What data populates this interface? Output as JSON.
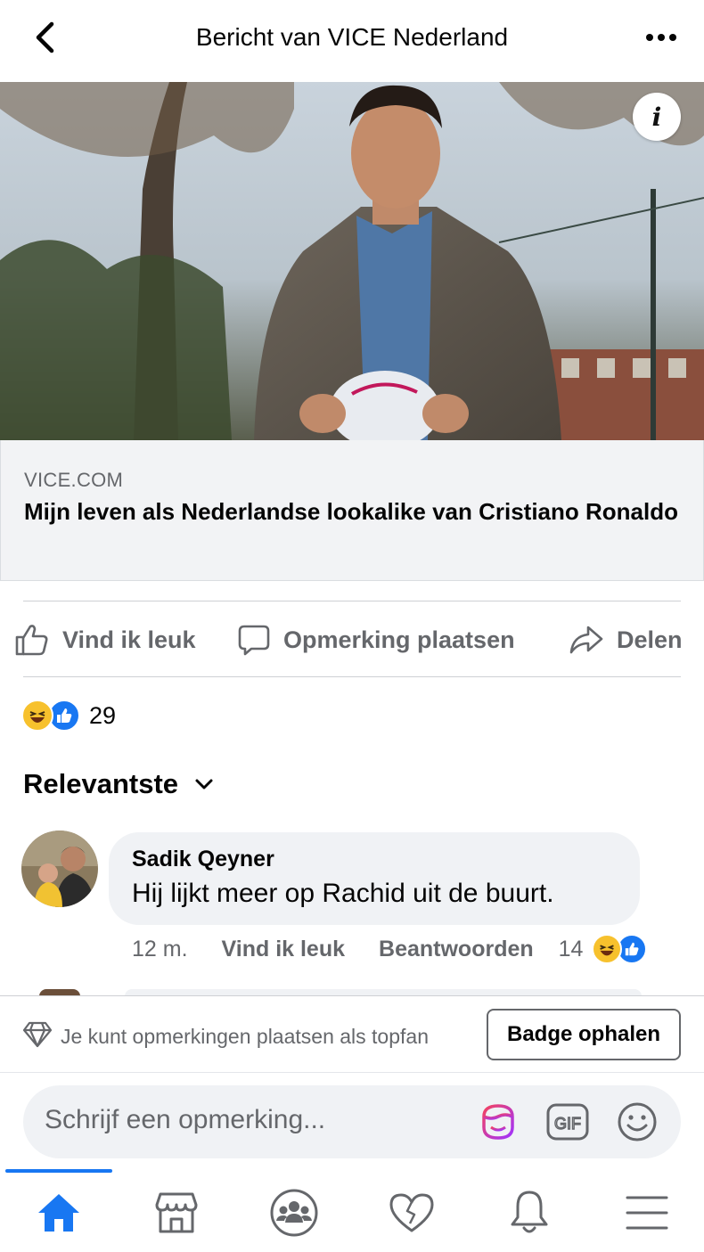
{
  "header": {
    "title": "Bericht van VICE Nederland",
    "back_icon": "chevron-left-icon",
    "more_icon": "more-dots-icon"
  },
  "hero": {
    "info_label": "i"
  },
  "link_preview": {
    "domain": "VICE.COM",
    "title": "Mijn leven als Nederlandse lookalike van Cristiano Ronaldo"
  },
  "actions": {
    "like_label": "Vind ik leuk",
    "comment_label": "Opmerking plaatsen",
    "share_label": "Delen"
  },
  "reactions": {
    "count": "29",
    "types": [
      "haha",
      "like"
    ]
  },
  "sort": {
    "label": "Relevantste"
  },
  "comment": {
    "author": "Sadik Qeyner",
    "text": "Hij lijkt meer op Rachid uit de buurt.",
    "time": "12 m.",
    "like_label": "Vind ik leuk",
    "reply_label": "Beantwoorden",
    "reaction_count": "14"
  },
  "topfan": {
    "text": "Je kunt opmerkingen plaatsen als topfan",
    "button_label": "Badge ophalen"
  },
  "composer": {
    "placeholder": "Schrijf een opmerking..."
  },
  "nav": {
    "items": [
      "home-icon",
      "marketplace-icon",
      "groups-icon",
      "dating-icon",
      "notifications-icon",
      "menu-icon"
    ],
    "active": "home-icon"
  },
  "colors": {
    "brand_blue": "#1877f2",
    "muted_text": "#65676b",
    "bubble_bg": "#f0f2f5"
  }
}
